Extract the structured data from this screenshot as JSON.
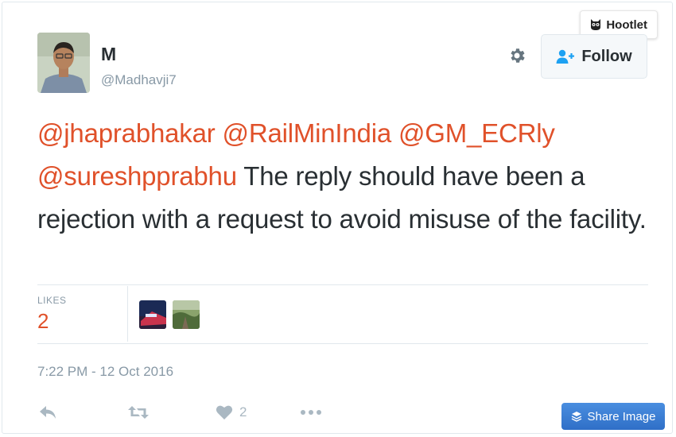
{
  "plugin": {
    "label": "Hootlet"
  },
  "author": {
    "name": "M",
    "handle": "@Madhavji7"
  },
  "header": {
    "follow_label": "Follow"
  },
  "tweet": {
    "mentions": [
      "@jhaprabhakar",
      "@RailMinIndia",
      "@GM_ECRly",
      "@sureshpprabhu"
    ],
    "body": "The reply should have been a rejection with a request to avoid misuse of the facility."
  },
  "stats": {
    "likes_label": "LIKES",
    "likes_count": "2"
  },
  "timestamp": "7:22 PM - 12 Oct 2016",
  "actions": {
    "like_count": "2"
  },
  "share": {
    "label": "Share Image"
  },
  "colors": {
    "mention": "#e0512a",
    "muted": "#8899a6",
    "share_button": "#3a7bd5"
  },
  "icons": [
    "owl-icon",
    "gear-icon",
    "add-user-icon",
    "reply-icon",
    "retweet-icon",
    "heart-icon",
    "more-icon",
    "layers-icon"
  ]
}
